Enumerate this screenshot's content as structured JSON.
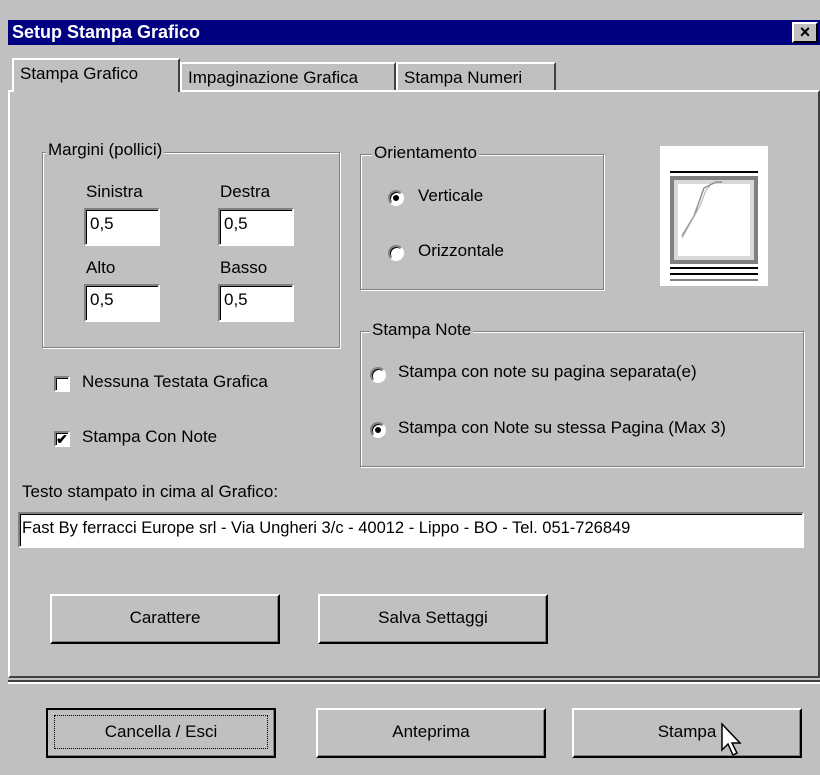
{
  "window": {
    "title": "Setup Stampa Grafico",
    "close_glyph": "×"
  },
  "tabs": [
    {
      "label": "Stampa Grafico",
      "active": true
    },
    {
      "label": "Impaginazione Grafica",
      "active": false
    },
    {
      "label": "Stampa Numeri",
      "active": false
    }
  ],
  "margins": {
    "legend": "Margini (pollici)",
    "left_label": "Sinistra",
    "left_value": "0,5",
    "right_label": "Destra",
    "right_value": "0,5",
    "top_label": "Alto",
    "top_value": "0,5",
    "bottom_label": "Basso",
    "bottom_value": "0,5"
  },
  "orientation": {
    "legend": "Orientamento",
    "options": [
      {
        "label": "Verticale",
        "selected": true
      },
      {
        "label": "Orizzontale",
        "selected": false
      }
    ],
    "preview_icon": "page-preview-icon"
  },
  "notes": {
    "legend": "Stampa Note",
    "options": [
      {
        "label": "Stampa con note su pagina separata(e)",
        "selected": false
      },
      {
        "label": "Stampa con Note su stessa Pagina (Max 3)",
        "selected": true
      }
    ]
  },
  "checkboxes": [
    {
      "label": "Nessuna Testata Grafica",
      "checked": false
    },
    {
      "label": "Stampa Con Note",
      "checked": true
    }
  ],
  "header_text": {
    "label": "Testo stampato in cima al Grafico:",
    "value": "Fast By ferracci Europe srl - Via Ungheri 3/c - 40012 - Lippo - BO - Tel. 051-726849"
  },
  "buttons": {
    "font": "Carattere",
    "save": "Salva Settaggi",
    "cancel": "Cancella / Esci",
    "preview": "Anteprima",
    "print": "Stampa"
  },
  "check_glyph": "✔"
}
